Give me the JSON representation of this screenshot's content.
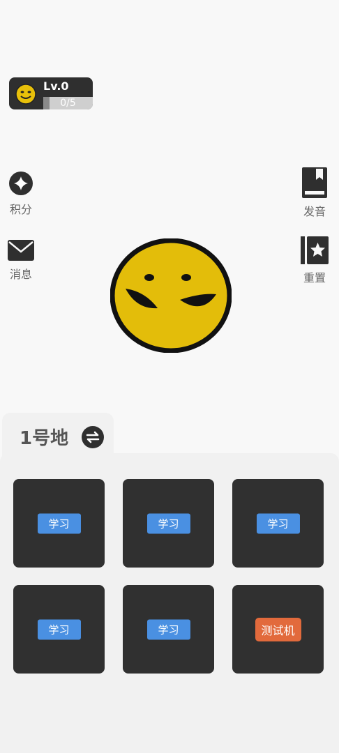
{
  "level": {
    "label": "Lv.0",
    "progress_text": "0/5",
    "progress": 0
  },
  "left_buttons": [
    {
      "label": "积分",
      "icon": "diamond-icon"
    },
    {
      "label": "消息",
      "icon": "envelope-icon"
    }
  ],
  "right_buttons": [
    {
      "label": "发音",
      "icon": "bookmark-book-icon"
    },
    {
      "label": "重置",
      "icon": "star-book-icon"
    }
  ],
  "land": {
    "title": "1号地",
    "swap_icon": "swap-icon"
  },
  "tiles": [
    {
      "label": "学习",
      "color": "#4a90e2"
    },
    {
      "label": "学习",
      "color": "#4a90e2"
    },
    {
      "label": "学习",
      "color": "#4a90e2"
    },
    {
      "label": "学习",
      "color": "#4a90e2"
    },
    {
      "label": "学习",
      "color": "#4a90e2"
    },
    {
      "label": "测试机",
      "color": "#e26a3c"
    }
  ]
}
